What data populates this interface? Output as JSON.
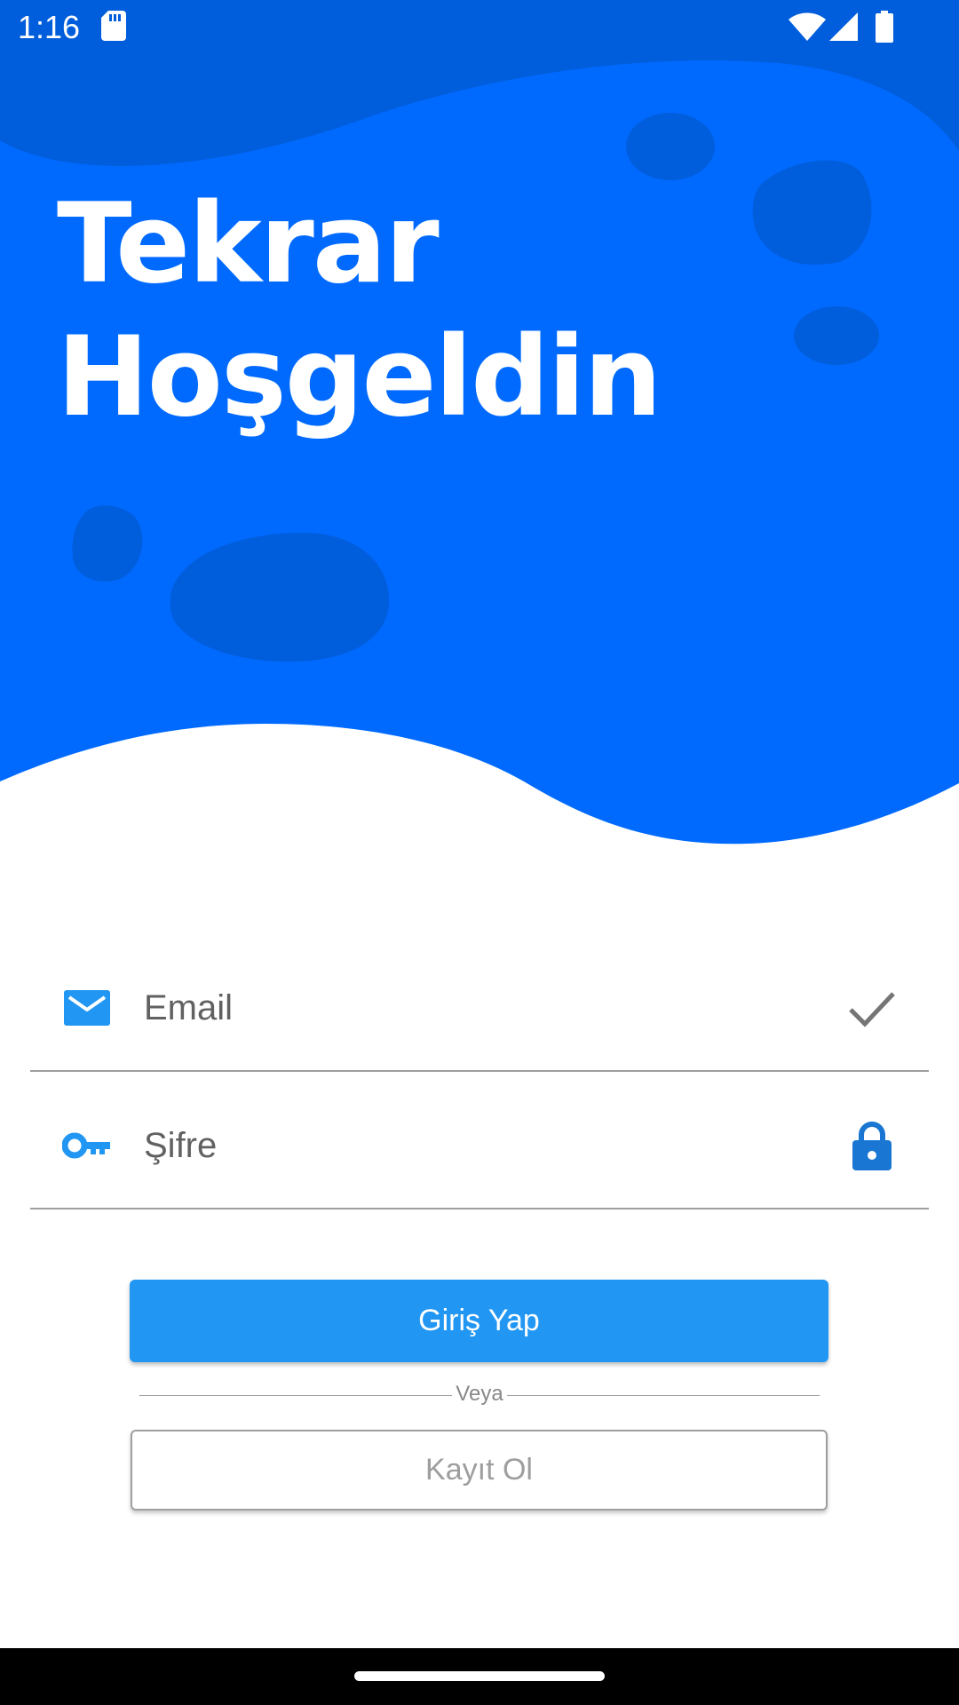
{
  "status_bar": {
    "time": "1:16"
  },
  "hero": {
    "title_line1": "Tekrar",
    "title_line2": "Hoşgeldin"
  },
  "form": {
    "email": {
      "placeholder": "Email",
      "value": "",
      "lead_icon": "mail-icon",
      "trail_icon": "check-icon"
    },
    "password": {
      "placeholder": "Şifre",
      "value": "",
      "lead_icon": "key-icon",
      "trail_icon": "lock-icon"
    },
    "login_label": "Giriş Yap",
    "or_label": "Veya",
    "register_label": "Kayıt Ol"
  },
  "colors": {
    "hero_blue": "#006aff",
    "hero_dark_blue": "#005ddb",
    "accent_blue": "#2196f3",
    "divider_gray": "#9e9e9e"
  }
}
